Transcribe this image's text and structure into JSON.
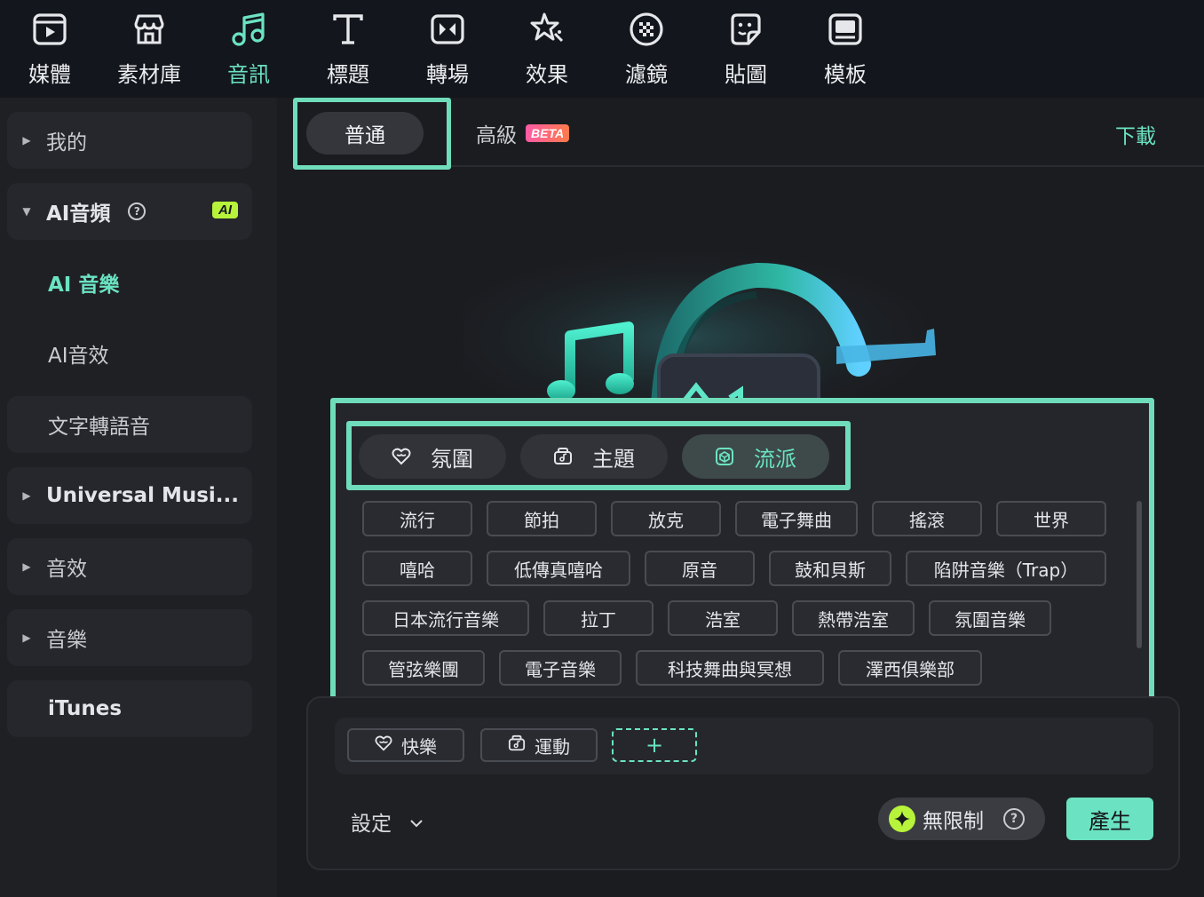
{
  "toolbar": {
    "items": [
      {
        "label": "媒體",
        "icon": "media-icon"
      },
      {
        "label": "素材庫",
        "icon": "store-icon"
      },
      {
        "label": "音訊",
        "icon": "music-note-icon"
      },
      {
        "label": "標題",
        "icon": "title-t-icon"
      },
      {
        "label": "轉場",
        "icon": "transition-icon"
      },
      {
        "label": "效果",
        "icon": "effects-star-icon"
      },
      {
        "label": "濾鏡",
        "icon": "filter-icon"
      },
      {
        "label": "貼圖",
        "icon": "sticker-icon"
      },
      {
        "label": "模板",
        "icon": "template-icon"
      }
    ],
    "active": "音訊",
    "accent_color": "#6be3c3"
  },
  "sidebar": {
    "mine": "我的",
    "ai_audio": "AI音頻",
    "ai_badge": "AI",
    "help": "?",
    "ai_music": "AI 音樂",
    "ai_sfx": "AI音效",
    "tts": "文字轉語音",
    "universal": "Universal Musi...",
    "sound_effects": "音效",
    "music": "音樂",
    "itunes": "iTunes"
  },
  "main": {
    "tab_normal": "普通",
    "tab_advanced": "高級",
    "beta": "BETA",
    "download": "下載"
  },
  "categories": [
    {
      "label": "氛圍",
      "icon": "heart-icon"
    },
    {
      "label": "主題",
      "icon": "theme-icon"
    },
    {
      "label": "流派",
      "icon": "genre-cube-icon"
    }
  ],
  "active_category": "流派",
  "genres": [
    [
      "流行",
      "節拍",
      "放克",
      "電子舞曲",
      "搖滾",
      "世界"
    ],
    [
      "嘻哈",
      "低傳真嘻哈",
      "原音",
      "鼓和貝斯",
      "陷阱音樂（Trap）"
    ],
    [
      "日本流行音樂",
      "拉丁",
      "浩室",
      "熱帶浩室",
      "氛圍音樂"
    ],
    [
      "管弦樂團",
      "電子音樂",
      "科技舞曲與冥想",
      "澤西俱樂部"
    ]
  ],
  "selected_tags": [
    {
      "label": "快樂",
      "icon": "heart-icon"
    },
    {
      "label": "運動",
      "icon": "theme-icon"
    }
  ],
  "add_tag": "+",
  "settings": "設定",
  "unlimited": "無限制",
  "generate": "產生"
}
